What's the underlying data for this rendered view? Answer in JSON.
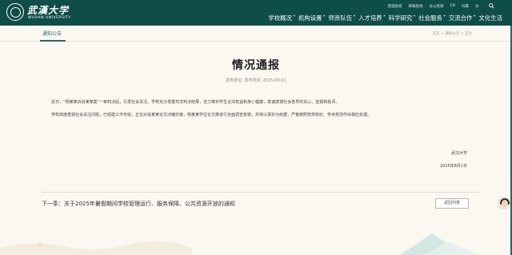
{
  "header": {
    "logo_cn": "武漢大学",
    "logo_en": "WUHAN UNIVERSITY",
    "top_links": [
      "管理系统",
      "邮箱系统",
      "办公系统",
      "EN",
      "归属",
      "文-"
    ],
    "nav": [
      "学校概况",
      "机构设置",
      "师资队伍",
      "人才培养",
      "科学研究",
      "社会服务",
      "交流合作",
      "文化生活"
    ]
  },
  "subbar": {
    "active_tab": "通知公告",
    "breadcrumb": "首页 > 通知公告 > 正文"
  },
  "article": {
    "title": "情况通报",
    "meta": "发布单位:  发布时间:  2025-08-01",
    "para1": "近日，“杨某某诉肖某某案”一审判决后，引发社会关注。学校充分尊重司法判决结果，全力维护学生合法权益和身心健康，真诚感谢社会各界的关心、监督和批评。",
    "para2": "学校高度重视社会关注问题，已组建工作专班，正在对肖某某论文涉嫌抄袭，杨某某学位论文推进行全面调查复核，并将以事实为依据，严格按照校规校纪、学术规范作出相应处理。",
    "sign_org": "武汉大学",
    "sign_date": "2025年8月1日"
  },
  "footer_nav": {
    "next_link": "下一条：关于2025年暑假期间学校管理运行、服务保障、公共资源开放的通知",
    "back_button": "返回列表"
  }
}
